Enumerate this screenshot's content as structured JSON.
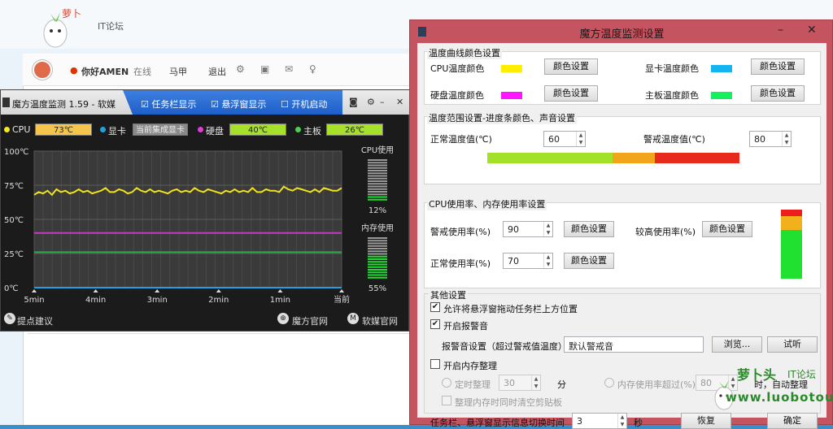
{
  "background": {
    "logo_text": "IT论坛",
    "userbar": {
      "greeting": "你好AMEN",
      "status": "在线",
      "name": "马甲",
      "logout": "退出"
    }
  },
  "monitor": {
    "title": "魔方温度监测 1.59 - 软媒",
    "options": [
      "任务栏显示",
      "悬浮窗显示",
      "开机启动"
    ],
    "status": [
      {
        "label": "CPU",
        "value": "73℃",
        "color": "#f6c64a",
        "dot": "#f8e71c"
      },
      {
        "label": "显卡",
        "value": "当前集成显卡",
        "color": "#9a9a9a",
        "dot": "#1fa2e0"
      },
      {
        "label": "硬盘",
        "value": "40℃",
        "color": "#a6e02a",
        "dot": "#e33bd6"
      },
      {
        "label": "主板",
        "value": "26℃",
        "color": "#a6e02a",
        "dot": "#4ccf4c"
      }
    ],
    "chart_data": {
      "type": "line",
      "y_ticks": [
        "100℃",
        "75℃",
        "50℃",
        "25℃",
        "0℃"
      ],
      "x_ticks": [
        "5min",
        "4min",
        "3min",
        "2min",
        "1min",
        "当前"
      ],
      "ylim": [
        0,
        100
      ],
      "series": [
        {
          "name": "CPU",
          "color": "#f2e21c",
          "values": [
            68,
            70,
            69,
            71,
            68,
            72,
            70,
            71,
            69,
            70,
            72,
            70,
            71,
            69,
            70,
            71,
            73,
            70,
            70,
            72,
            71,
            69,
            70,
            73,
            71,
            70,
            72,
            70,
            71,
            70,
            69,
            71,
            72,
            70,
            71,
            70,
            73,
            71,
            70,
            72,
            71,
            70,
            69,
            71,
            70,
            72,
            70,
            71,
            70,
            73,
            70,
            70,
            72,
            71,
            71,
            70,
            74,
            72,
            71,
            73,
            72,
            71,
            70,
            72,
            70,
            73,
            72,
            71,
            71,
            73
          ]
        },
        {
          "name": "硬盘",
          "color": "#c63bc6",
          "values": [
            40
          ]
        },
        {
          "name": "主板",
          "color": "#2fa84a",
          "values": [
            26
          ]
        },
        {
          "name": "显卡",
          "color": "#1fa2e0",
          "values": [
            0
          ]
        }
      ]
    },
    "cpu_usage_label": "CPU使用",
    "cpu_usage_value": "12%",
    "cpu_usage_frac": 0.12,
    "mem_usage_label": "内存使用",
    "mem_usage_value": "55%",
    "mem_usage_frac": 0.55,
    "footer": {
      "suggest": "提点建议",
      "mofang": "魔方官网",
      "ruanmei": "软媒官网"
    }
  },
  "dialog": {
    "title": "魔方温度监测设置",
    "color_group": {
      "title": "温度曲线颜色设置",
      "items": [
        {
          "label": "CPU温度颜色",
          "color": "#ffee00",
          "button": "颜色设置"
        },
        {
          "label": "显卡温度颜色",
          "color": "#14b4f0",
          "button": "颜色设置"
        },
        {
          "label": "硬盘温度颜色",
          "color": "#ff18ff",
          "button": "颜色设置"
        },
        {
          "label": "主板温度颜色",
          "color": "#14f060",
          "button": "颜色设置"
        }
      ]
    },
    "range_group": {
      "title": "温度范围设置-进度条颜色、声音设置",
      "normal_label": "正常温度值(℃)",
      "normal_value": "60",
      "warn_label": "警戒温度值(℃)",
      "warn_value": "80",
      "bar_colors": [
        "#a3e02a",
        "#f2a51c",
        "#e82a1c"
      ]
    },
    "usage_group": {
      "title": "CPU使用率、内存使用率设置",
      "warn_label": "警戒使用率(%)",
      "warn_value": "90",
      "warn_button": "颜色设置",
      "high_label": "较高使用率(%)",
      "high_button": "颜色设置",
      "normal_label": "正常使用率(%)",
      "normal_value": "70",
      "normal_button": "颜色设置",
      "indicator_colors": [
        "#ee1c1c",
        "#f2b01c",
        "#20e030"
      ]
    },
    "other_group": {
      "title": "其他设置",
      "allow_drag": "允许将悬浮窗拖动任务栏上方位置",
      "enable_alarm": "开启报警音",
      "alarm_label": "报警音设置（超过警戒值温度）",
      "alarm_value": "默认警戒音",
      "browse": "浏览...",
      "listen": "试听",
      "memory_clean": "开启内存整理",
      "timed_label": "定时整理",
      "timed_value": "30",
      "timed_unit": "分",
      "mem_over_label": "内存使用率超过(%)",
      "mem_over_value": "80",
      "mem_over_suffix": "时，自动整理",
      "clear_clip": "整理内存时同时清空剪贴板",
      "switch_label": "任务栏、悬浮窗显示信息切换时间",
      "switch_value": "3",
      "switch_unit": "秒",
      "restore": "恢复",
      "ok": "确定"
    }
  },
  "watermark": {
    "text1": "萝卜头",
    "text2": "IT论坛",
    "url": "www.luobotou.pw"
  }
}
